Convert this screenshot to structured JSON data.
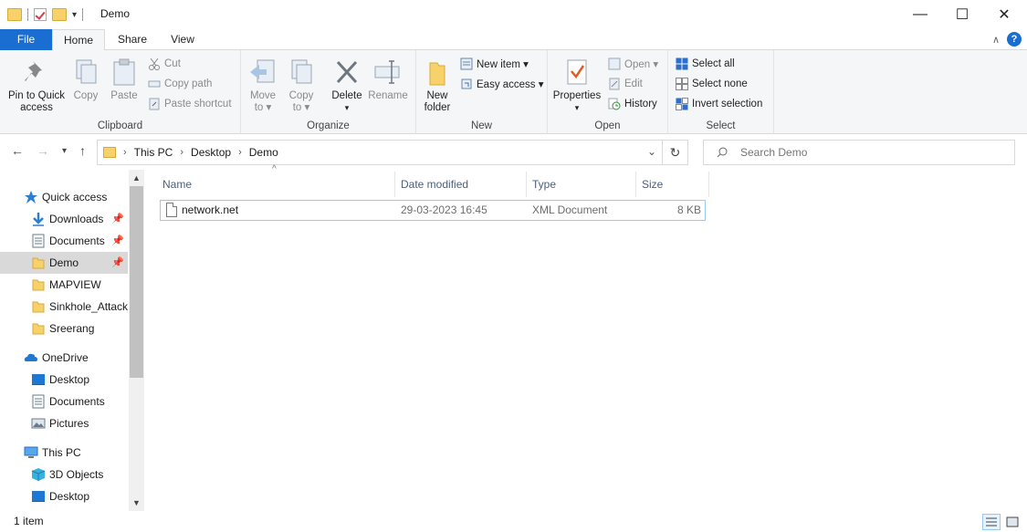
{
  "window": {
    "title": "Demo"
  },
  "tabs": {
    "file": "File",
    "home": "Home",
    "share": "Share",
    "view": "View",
    "help": "?"
  },
  "ribbon": {
    "clipboard": {
      "label": "Clipboard",
      "pin": [
        "Pin to Quick",
        "access"
      ],
      "copy": "Copy",
      "paste": "Paste",
      "cut": "Cut",
      "copy_path": "Copy path",
      "paste_shortcut": "Paste shortcut"
    },
    "organize": {
      "label": "Organize",
      "move_to": [
        "Move",
        "to ▾"
      ],
      "copy_to": [
        "Copy",
        "to ▾"
      ],
      "delete": [
        "Delete",
        "▾"
      ],
      "rename": "Rename"
    },
    "new": {
      "label": "New",
      "new_folder": [
        "New",
        "folder"
      ],
      "new_item": "New item ▾",
      "easy_access": "Easy access ▾"
    },
    "open": {
      "label": "Open",
      "properties": [
        "Properties",
        "▾"
      ],
      "open": "Open ▾",
      "edit": "Edit",
      "history": "History"
    },
    "select": {
      "label": "Select",
      "select_all": "Select all",
      "select_none": "Select none",
      "invert": "Invert selection"
    }
  },
  "address": {
    "crumbs": [
      "This PC",
      "Desktop",
      "Demo"
    ],
    "search_placeholder": "Search Demo"
  },
  "nav": {
    "items": [
      {
        "label": "Quick access",
        "icon": "star-icon"
      },
      {
        "label": "Downloads",
        "icon": "download-icon",
        "pinned": true
      },
      {
        "label": "Documents",
        "icon": "documents-icon",
        "pinned": true
      },
      {
        "label": "Demo",
        "icon": "folder-icon",
        "pinned": true,
        "selected": true
      },
      {
        "label": "MAPVIEW",
        "icon": "folder-icon"
      },
      {
        "label": "Sinkhole_Attack_",
        "icon": "folder-icon"
      },
      {
        "label": "Sreerang",
        "icon": "folder-icon"
      },
      {
        "label": "OneDrive",
        "icon": "cloud-icon"
      },
      {
        "label": "Desktop",
        "icon": "desktop-icon"
      },
      {
        "label": "Documents",
        "icon": "documents-icon"
      },
      {
        "label": "Pictures",
        "icon": "pictures-icon"
      },
      {
        "label": "This PC",
        "icon": "computer-icon"
      },
      {
        "label": "3D Objects",
        "icon": "cube-icon"
      },
      {
        "label": "Desktop",
        "icon": "desktop-icon"
      }
    ]
  },
  "files": {
    "columns": [
      "Name",
      "Date modified",
      "Type",
      "Size"
    ],
    "rows": [
      {
        "name": "network.net",
        "date": "29-03-2023 16:45",
        "type": "XML Document",
        "size": "8 KB"
      }
    ]
  },
  "status": {
    "count": "1 item"
  },
  "colors": {
    "accent": "#1a6ed1",
    "folder": "#f7d26b",
    "selection": "#d9d9d9"
  }
}
